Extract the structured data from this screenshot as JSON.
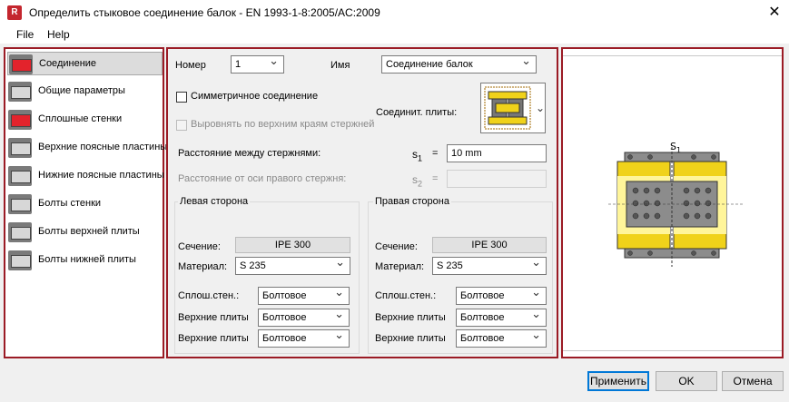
{
  "window": {
    "app_icon_text": "R",
    "title": "Определить стыковое соединение балок - EN 1993-1-8:2005/AC:2009",
    "close": "✕"
  },
  "menu": {
    "file": "File",
    "help": "Help"
  },
  "nav": {
    "items": [
      {
        "label": "Соединение",
        "icon": "connection-icon",
        "selected": true
      },
      {
        "label": "Общие параметры",
        "icon": "general-params-icon"
      },
      {
        "label": "Сплошные стенки",
        "icon": "web-icon"
      },
      {
        "label": "Верхние поясные пластины",
        "icon": "top-flange-plates-icon"
      },
      {
        "label": "Нижние поясные пластины",
        "icon": "bottom-flange-plates-icon"
      },
      {
        "label": "Болты стенки",
        "icon": "web-bolts-icon"
      },
      {
        "label": "Болты верхней плиты",
        "icon": "top-plate-bolts-icon"
      },
      {
        "label": "Болты нижней плиты",
        "icon": "bottom-plate-bolts-icon"
      }
    ]
  },
  "form": {
    "number_label": "Номер",
    "number_value": "1",
    "name_label": "Имя",
    "name_value": "Соединение балок",
    "symmetric_label": "Симметричное соединение",
    "align_label": "Выровнять по верхним краям стержней",
    "plates_label": "Соединит. плиты:",
    "distance_label": "Расстояние между стержнями:",
    "s1_base": "s",
    "s1_sub": "1",
    "eq": "=",
    "s1_value": "10 mm",
    "offset_label": "Расстояние от оси правого стержня:",
    "s2_base": "s",
    "s2_sub": "2"
  },
  "left_side": {
    "title": "Левая сторона",
    "section_label": "Сечение:",
    "section_value": "IPE 300",
    "material_label": "Материал:",
    "material_value": "S 235",
    "web_label": "Сплош.стен.:",
    "web_value": "Болтовое",
    "top_label": "Верхние плиты",
    "top_value": "Болтовое",
    "bottom_label": "Верхние плиты",
    "bottom_value": "Болтовое"
  },
  "right_side": {
    "title": "Правая сторона",
    "section_label": "Сечение:",
    "section_value": "IPE 300",
    "material_label": "Материал:",
    "material_value": "S 235",
    "web_label": "Сплош.стен.:",
    "web_value": "Болтовое",
    "top_label": "Верхние плиты",
    "top_value": "Болтовое",
    "bottom_label": "Верхние плиты",
    "bottom_value": "Болтовое"
  },
  "diagram": {
    "dim_base": "S",
    "dim_sub": "1",
    "beam_color": "#f0d21a",
    "plate_color": "#8c8c8c"
  },
  "buttons": {
    "apply": "Применить",
    "ok": "OK",
    "cancel": "Отмена"
  }
}
